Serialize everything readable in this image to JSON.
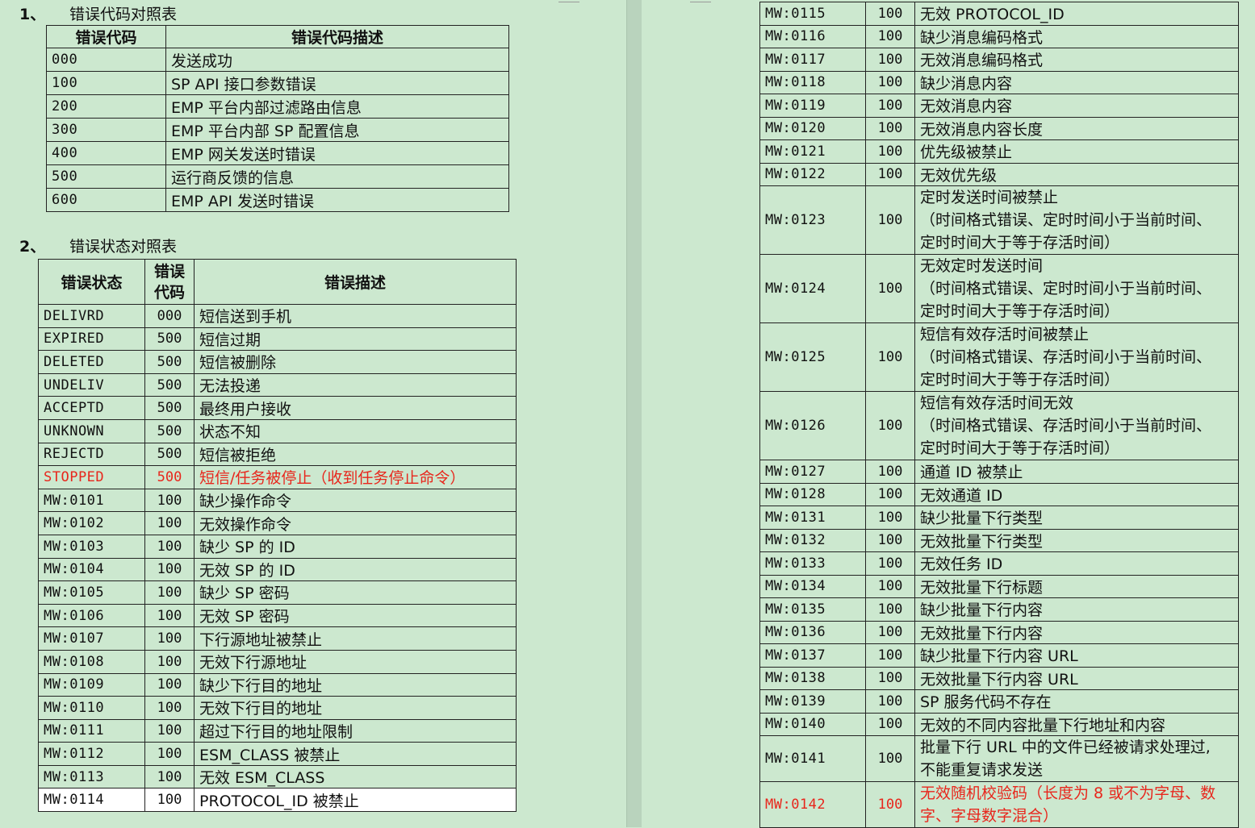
{
  "section1": {
    "num": "1、",
    "title": "错误代码对照表",
    "headers": [
      "错误代码",
      "错误代码描述"
    ],
    "rows": [
      [
        "000",
        "发送成功"
      ],
      [
        "100",
        "SP API 接口参数错误"
      ],
      [
        "200",
        "EMP 平台内部过滤路由信息"
      ],
      [
        "300",
        "EMP 平台内部 SP 配置信息"
      ],
      [
        "400",
        "EMP 网关发送时错误"
      ],
      [
        "500",
        "运行商反馈的信息"
      ],
      [
        "600",
        "EMP API 发送时错误"
      ]
    ]
  },
  "section2": {
    "num": "2、",
    "title": "错误状态对照表",
    "headers": [
      "错误状态",
      "错误代码",
      "错误描述"
    ],
    "rows": [
      [
        "DELIVRD",
        "000",
        "短信送到手机"
      ],
      [
        "EXPIRED",
        "500",
        "短信过期"
      ],
      [
        "DELETED",
        "500",
        "短信被删除"
      ],
      [
        "UNDELIV",
        "500",
        "无法投递"
      ],
      [
        "ACCEPTD",
        "500",
        "最终用户接收"
      ],
      [
        "UNKNOWN",
        "500",
        "状态不知"
      ],
      [
        "REJECTD",
        "500",
        "短信被拒绝"
      ],
      [
        "STOPPED",
        "500",
        "短信/任务被停止（收到任务停止命令）"
      ],
      [
        "MW:0101",
        "100",
        "缺少操作命令"
      ],
      [
        "MW:0102",
        "100",
        "无效操作命令"
      ],
      [
        "MW:0103",
        "100",
        "缺少 SP 的 ID"
      ],
      [
        "MW:0104",
        "100",
        "无效 SP 的 ID"
      ],
      [
        "MW:0105",
        "100",
        "缺少 SP 密码"
      ],
      [
        "MW:0106",
        "100",
        "无效 SP 密码"
      ],
      [
        "MW:0107",
        "100",
        "下行源地址被禁止"
      ],
      [
        "MW:0108",
        "100",
        "无效下行源地址"
      ],
      [
        "MW:0109",
        "100",
        "缺少下行目的地址"
      ],
      [
        "MW:0110",
        "100",
        "无效下行目的地址"
      ],
      [
        "MW:0111",
        "100",
        "超过下行目的地址限制"
      ],
      [
        "MW:0112",
        "100",
        "ESM_CLASS 被禁止"
      ],
      [
        "MW:0113",
        "100",
        "无效 ESM_CLASS"
      ],
      [
        "MW:0114",
        "100",
        "PROTOCOL_ID 被禁止"
      ]
    ],
    "continued_rows": [
      [
        "MW:0115",
        "100",
        "无效 PROTOCOL_ID"
      ],
      [
        "MW:0116",
        "100",
        "缺少消息编码格式"
      ],
      [
        "MW:0117",
        "100",
        "无效消息编码格式"
      ],
      [
        "MW:0118",
        "100",
        "缺少消息内容"
      ],
      [
        "MW:0119",
        "100",
        "无效消息内容"
      ],
      [
        "MW:0120",
        "100",
        "无效消息内容长度"
      ],
      [
        "MW:0121",
        "100",
        "优先级被禁止"
      ],
      [
        "MW:0122",
        "100",
        "无效优先级"
      ],
      [
        "MW:0123",
        "100",
        "定时发送时间被禁止\n（时间格式错误、定时时间小于当前时间、\n定时时间大于等于存活时间）"
      ],
      [
        "MW:0124",
        "100",
        "无效定时发送时间\n（时间格式错误、定时时间小于当前时间、\n定时时间大于等于存活时间）"
      ],
      [
        "MW:0125",
        "100",
        "短信有效存活时间被禁止\n（时间格式错误、存活时间小于当前时间、\n定时时间大于等于存活时间）"
      ],
      [
        "MW:0126",
        "100",
        "短信有效存活时间无效\n（时间格式错误、存活时间小于当前时间、\n定时时间大于等于存活时间）"
      ],
      [
        "MW:0127",
        "100",
        "通道 ID 被禁止"
      ],
      [
        "MW:0128",
        "100",
        "无效通道 ID"
      ],
      [
        "MW:0131",
        "100",
        "缺少批量下行类型"
      ],
      [
        "MW:0132",
        "100",
        "无效批量下行类型"
      ],
      [
        "MW:0133",
        "100",
        "无效任务 ID"
      ],
      [
        "MW:0134",
        "100",
        "无效批量下行标题"
      ],
      [
        "MW:0135",
        "100",
        "缺少批量下行内容"
      ],
      [
        "MW:0136",
        "100",
        "无效批量下行内容"
      ],
      [
        "MW:0137",
        "100",
        "缺少批量下行内容 URL"
      ],
      [
        "MW:0138",
        "100",
        "无效批量下行内容 URL"
      ],
      [
        "MW:0139",
        "100",
        "SP 服务代码不存在"
      ],
      [
        "MW:0140",
        "100",
        "无效的不同内容批量下行地址和内容"
      ],
      [
        "MW:0141",
        "100",
        "批量下行 URL 中的文件已经被请求处理过,\n不能重复请求发送"
      ],
      [
        "MW:0142",
        "100",
        "无效随机校验码（长度为 8 或不为字母、数\n字、字母数字混合）"
      ]
    ]
  },
  "highlight_color": "#e8261c"
}
